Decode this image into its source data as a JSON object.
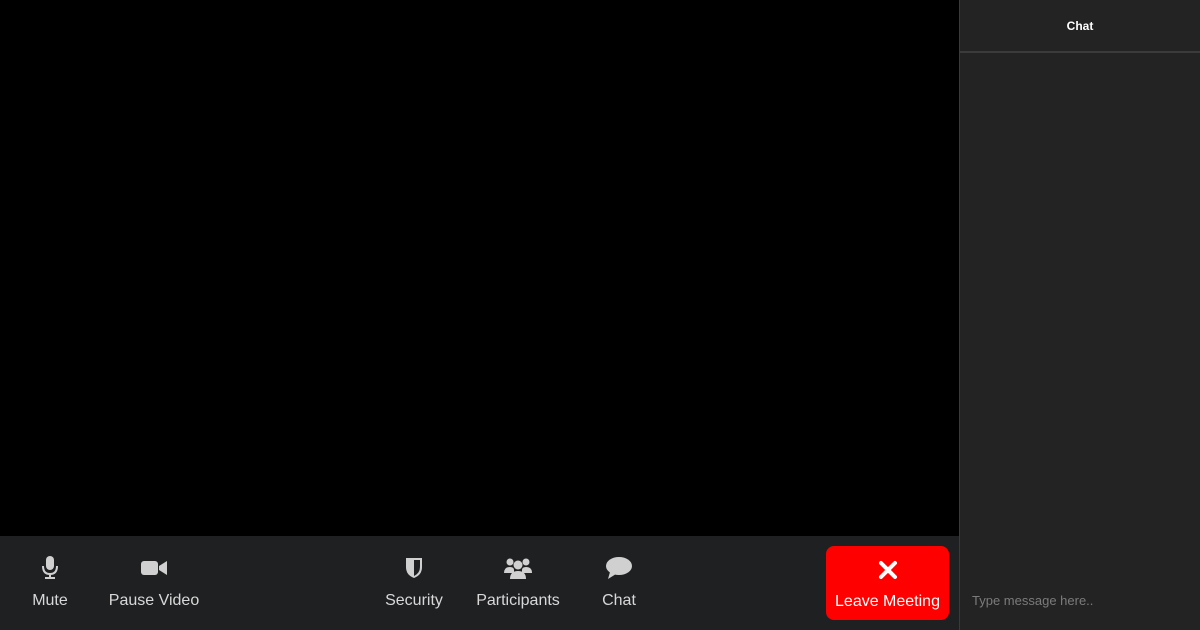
{
  "toolbar": {
    "mute_label": "Mute",
    "pause_video_label": "Pause Video",
    "security_label": "Security",
    "participants_label": "Participants",
    "chat_label": "Chat",
    "leave_label": "Leave Meeting"
  },
  "chat_panel": {
    "title": "Chat",
    "input_placeholder": "Type message here.."
  },
  "colors": {
    "toolbar_bg": "#1f2022",
    "leave_button": "#ff0000",
    "panel_bg": "#232323",
    "video_bg": "#000000"
  },
  "icons": {
    "mute": "microphone-icon",
    "pause_video": "video-camera-icon",
    "security": "shield-icon",
    "participants": "users-icon",
    "chat": "chat-bubble-icon",
    "leave": "close-icon"
  }
}
